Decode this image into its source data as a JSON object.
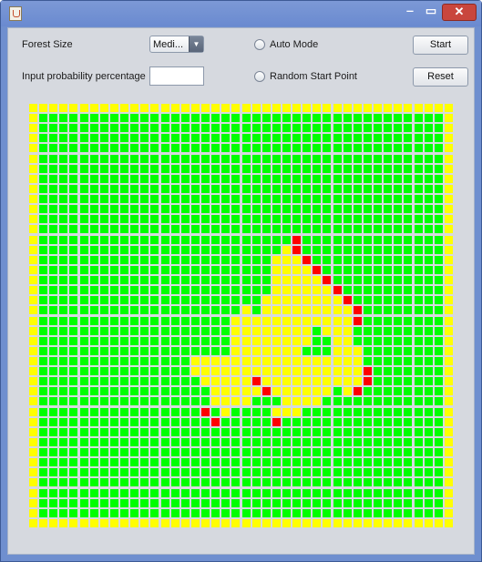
{
  "window": {
    "title": "",
    "controls": {
      "minimize": "‒",
      "maximize": "▭",
      "close": "✕"
    }
  },
  "controls": {
    "forest_size_label": "Forest Size",
    "forest_size_selected": "Medi...",
    "dropdown_arrow": "▼",
    "probability_label": "Input probability percentage",
    "probability_value": "",
    "auto_mode_label": "Auto Mode",
    "random_start_label": "Random Start Point",
    "start_label": "Start",
    "reset_label": "Reset"
  },
  "colors": {
    "tree": "#00ff00",
    "burnt": "#ffff00",
    "burning": "#ff0000",
    "border": "#ffff00"
  },
  "forest": {
    "size": 42,
    "legend": {
      "G": "tree",
      "Y": "burnt",
      "R": "burning"
    },
    "rows": [
      "YYYYYYYYYYYYYYYYYYYYYYYYYYYYYYYYYYYYYYYYYY",
      "YGGGGGGGGGGGGGGGGGGGGGGGGGGGGGGGGGGGGGGGGY",
      "YGGGGGGGGGGGGGGGGGGGGGGGGGGGGGGGGGGGGGGGGY",
      "YGGGGGGGGGGGGGGGGGGGGGGGGGGGGGGGGGGGGGGGGY",
      "YGGGGGGGGGGGGGGGGGGGGGGGGGGGGGGGGGGGGGGGGY",
      "YGGGGGGGGGGGGGGGGGGGGGGGGGGGGGGGGGGGGGGGGY",
      "YGGGGGGGGGGGGGGGGGGGGGGGGGGGGGGGGGGGGGGGGY",
      "YGGGGGGGGGGGGGGGGGGGGGGGGGGGGGGGGGGGGGGGGY",
      "YGGGGGGGGGGGGGGGGGGGGGGGGGGGGGGGGGGGGGGGGY",
      "YGGGGGGGGGGGGGGGGGGGGGGGGGGGGGGGGGGGGGGGGY",
      "YGGGGGGGGGGGGGGGGGGGGGGGGGGGGGGGGGGGGGGGGY",
      "YGGGGGGGGGGGGGGGGGGGGGGGGGGGGGGGGGGGGGGGGY",
      "YGGGGGGGGGGGGGGGGGGGGGGGGGGGGGGGGGGGGGGGGY",
      "YGGGGGGGGGGGGGGGGGGGGGGGGGRGGGGGGGGGGGGGGY",
      "YGGGGGGGGGGGGGGGGGGGGGGGGYRGGGGGGGGGGGGGGY",
      "YGGGGGGGGGGGGGGGGGGGGGGGYYYRGGGGGGGGGGGGGY",
      "YGGGGGGGGGGGGGGGGGGGGGGGYYYYRGGGGGGGGGGGGY",
      "YGGGGGGGGGGGGGGGGGGGGGGGYYYYYRGGGGGGGGGGGY",
      "YGGGGGGGGGGGGGGGGGGGGGGGYYYYYYRGGGGGGGGGGY",
      "YGGGGGGGGGGGGGGGGGGGGGGYYYYYYYYRGGGGGGGGGY",
      "YGGGGGGGGGGGGGGGGGGGGYGYYYYYYYYYRGGGGGGGGY",
      "YGGGGGGGGGGGGGGGGGGGYYYYYYYYYYYYRGGGGGGGGY",
      "YGGGGGGGGGGGGGGGGGGGYYYYYYYYGYYYGGGGGGGGGY",
      "YGGGGGGGGGGGGGGGGGGGYYYYYYYYGGYYGGGGGGGGGY",
      "YGGGGGGGGGGGGGGGGGGGYYYYYYYGGGYYYGGGGGGGGY",
      "YGGGGGGGGGGGGGGGYYYYYYYYYYYYYYYYYGGGGGGGGY",
      "YGGGGGGGGGGGGGGGYYYYYYYYYYYYYYYYYRGGGGGGGY",
      "YGGGGGGGGGGGGGGGGYYYYYRYYYYYYYYYYRGGGGGGGY",
      "YGGGGGGGGGGGGGGGGGYYYYYRYYYYYYGYRGGGGGGGGY",
      "YGGGGGGGGGGGGGGGGGYYYYGGGYYYYGGGGGGGGGGGGY",
      "YGGGGGGGGGGGGGGGGRGYGGGGYYYGGGGGGGGGGGGGGY",
      "YGGGGGGGGGGGGGGGGGRGGGGGRGGGGGGGGGGGGGGGGY",
      "YGGGGGGGGGGGGGGGGGGGGGGGGGGGGGGGGGGGGGGGGY",
      "YGGGGGGGGGGGGGGGGGGGGGGGGGGGGGGGGGGGGGGGGY",
      "YGGGGGGGGGGGGGGGGGGGGGGGGGGGGGGGGGGGGGGGGY",
      "YGGGGGGGGGGGGGGGGGGGGGGGGGGGGGGGGGGGGGGGGY",
      "YGGGGGGGGGGGGGGGGGGGGGGGGGGGGGGGGGGGGGGGGY",
      "YGGGGGGGGGGGGGGGGGGGGGGGGGGGGGGGGGGGGGGGGY",
      "YGGGGGGGGGGGGGGGGGGGGGGGGGGGGGGGGGGGGGGGGY",
      "YGGGGGGGGGGGGGGGGGGGGGGGGGGGGGGGGGGGGGGGGY",
      "YGGGGGGGGGGGGGGGGGGGGGGGGGGGGGGGGGGGGGGGGY",
      "YYYYYYYYYYYYYYYYYYYYYYYYYYYYYYYYYYYYYYYYYY"
    ]
  }
}
